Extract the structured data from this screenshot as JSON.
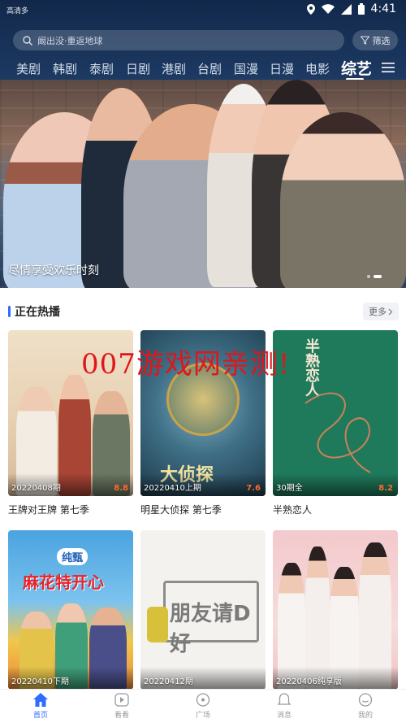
{
  "statusbar": {
    "carrier": "高清多",
    "time": "4:41"
  },
  "search": {
    "placeholder": "阚出没·重返地球"
  },
  "filter": {
    "label": "筛选"
  },
  "tabs": [
    "美剧",
    "韩剧",
    "泰剧",
    "日剧",
    "港剧",
    "台剧",
    "国漫",
    "日漫",
    "电影",
    "综艺"
  ],
  "active_tab": "综艺",
  "banner": {
    "caption": "尽情享受欢乐时刻"
  },
  "section": {
    "title": "正在热播",
    "more": "更多"
  },
  "watermark": "007游戏网亲测!",
  "cards": [
    {
      "name": "王牌对王牌 第七季",
      "ep": "20220408期",
      "score": "8.8"
    },
    {
      "name": "明星大侦探 第七季",
      "ep": "20220410上期",
      "score": "7.6",
      "poster_text": "大侦探"
    },
    {
      "name": "半熟恋人",
      "ep": "30期全",
      "score": "8.2",
      "poster_text": "半熟恋人"
    },
    {
      "name": "",
      "ep": "20220410下期",
      "score": "",
      "poster_text": "麻花特开心",
      "poster_sub": "纯甄"
    },
    {
      "name": "",
      "ep": "20220412期",
      "score": "",
      "poster_text": "朋友请D好"
    },
    {
      "name": "",
      "ep": "20220406纯享版",
      "score": ""
    }
  ],
  "bottom_nav": [
    "首页",
    "看看",
    "广场",
    "消息",
    "我的"
  ],
  "colors": {
    "accent": "#2f6bff",
    "header": "#11284a",
    "score": "#ff6b2a",
    "watermark": "#e0161b"
  }
}
